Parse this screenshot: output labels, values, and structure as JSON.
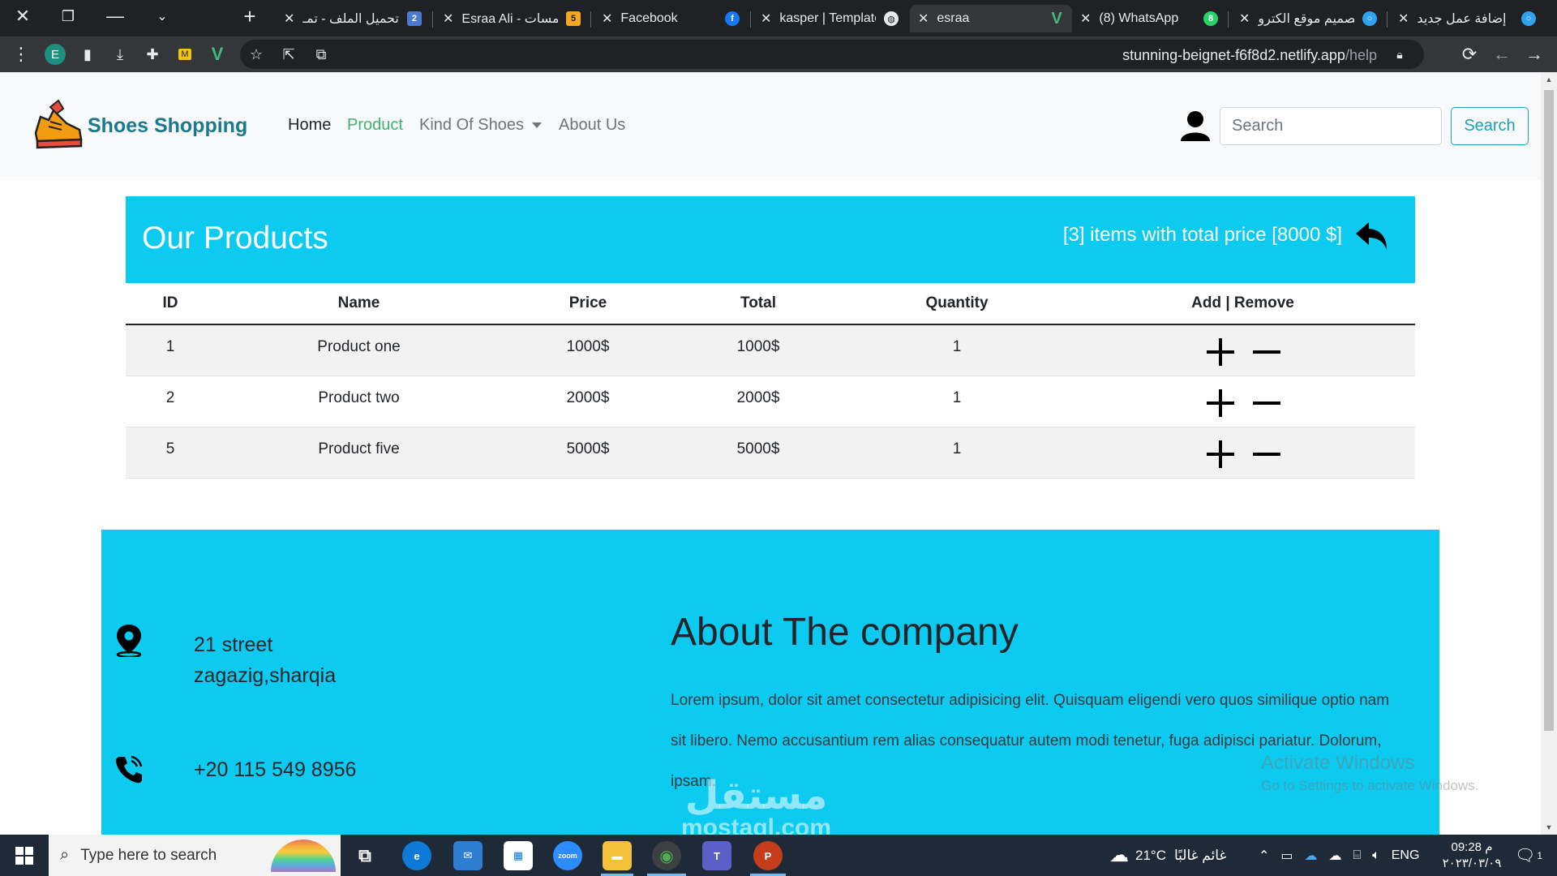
{
  "browser": {
    "tabs": [
      {
        "title": "تحميل الملف - تمـ",
        "badge": "2"
      },
      {
        "title": "Esraa Ali - خمسات",
        "badge": "5"
      },
      {
        "title": "Facebook"
      },
      {
        "title": "kasper | Template"
      },
      {
        "title": "esraa"
      },
      {
        "title": "(8) WhatsApp",
        "badge": "8"
      },
      {
        "title": "تصميم موقع الكترو"
      },
      {
        "title": "إضافة عمل جديد"
      }
    ],
    "profile_initial": "E",
    "url_host": "stunning-beignet-f6f8d2.netlify.app",
    "url_path": "/help"
  },
  "navbar": {
    "brand": "Shoes Shopping",
    "links": {
      "home": "Home",
      "product": "Product",
      "kind": "Kind Of Shoes",
      "about": "About Us"
    },
    "search_placeholder": "Search",
    "search_button": "Search"
  },
  "products": {
    "title": "Our Products",
    "summary": "[3] items with total price [8000 $]",
    "columns": [
      "ID",
      "Name",
      "Price",
      "Total",
      "Quantity",
      "Add | Remove"
    ],
    "rows": [
      {
        "id": "1",
        "name": "Product one",
        "price": "1000$",
        "total": "1000$",
        "quantity": "1"
      },
      {
        "id": "2",
        "name": "Product two",
        "price": "2000$",
        "total": "2000$",
        "quantity": "1"
      },
      {
        "id": "5",
        "name": "Product five",
        "price": "5000$",
        "total": "5000$",
        "quantity": "1"
      }
    ]
  },
  "footer": {
    "address_line1": "21 street",
    "address_line2": "zagazig,sharqia",
    "phone": "+20 115 549 8956",
    "about_title": "About The company",
    "about_text": "Lorem ipsum, dolor sit amet consectetur adipisicing elit. Quisquam eligendi vero quos similique optio nam sit libero. Nemo accusantium rem alias consequatur autem modi tenetur, fuga adipisci pariatur. Dolorum, ipsam."
  },
  "overlay": {
    "activate_title": "Activate Windows",
    "activate_sub": "Go to Settings to activate Windows.",
    "logo_arabic": "مستقل",
    "logo_latin": "mostaql.com"
  },
  "taskbar": {
    "search_placeholder": "Type here to search",
    "weather_temp": "21°C",
    "weather_text": "غائم غالبًا",
    "language": "ENG",
    "time": "09:28 م",
    "date": "٢٠٢٣/٠٣/٠٩",
    "notification_count": "1"
  }
}
